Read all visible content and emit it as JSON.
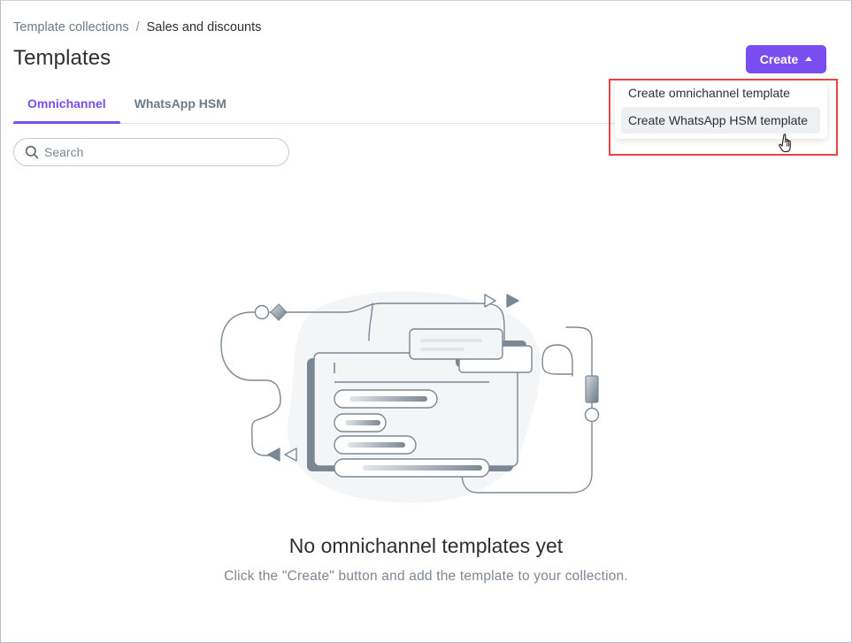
{
  "breadcrumb": {
    "parent": "Template collections",
    "separator": "/",
    "current": "Sales and discounts"
  },
  "page": {
    "title": "Templates"
  },
  "create_button": {
    "label": "Create",
    "accent": "#7a4df0"
  },
  "tabs": [
    {
      "label": "Omnichannel",
      "active": true
    },
    {
      "label": "WhatsApp HSM",
      "active": false
    }
  ],
  "search": {
    "placeholder": "Search",
    "value": ""
  },
  "create_menu": {
    "items": [
      {
        "label": "Create omnichannel template"
      },
      {
        "label": "Create WhatsApp HSM template",
        "hovered": true
      }
    ]
  },
  "empty_state": {
    "title": "No omnichannel templates yet",
    "subtitle": "Click the \"Create\" button and add the template to your collection."
  },
  "icons": {
    "search": "search-icon",
    "caret": "caret-up-icon",
    "cursor": "hand-pointer-icon"
  }
}
